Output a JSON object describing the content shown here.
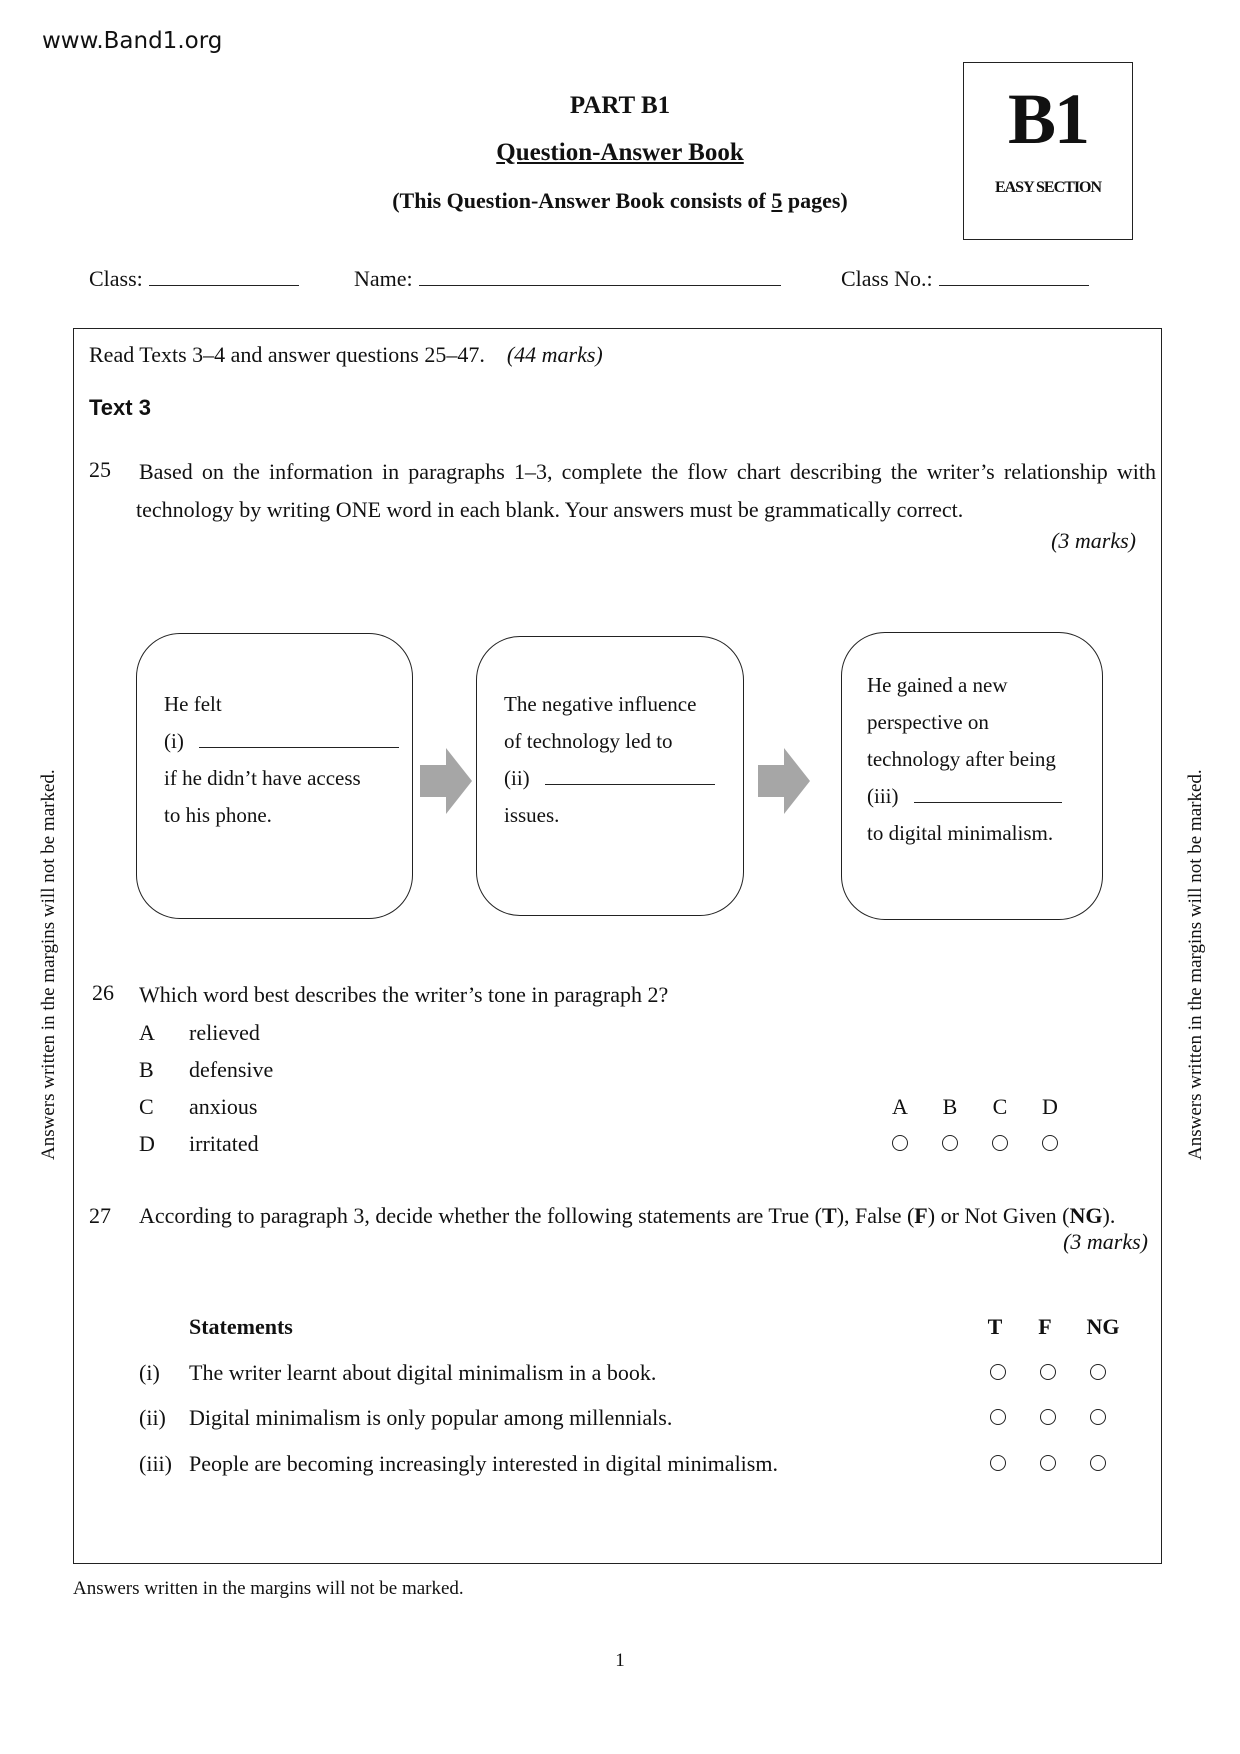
{
  "site": "www.Band1.org",
  "header": {
    "part": "PART B1",
    "title": "Question-Answer Book",
    "consists_prefix": "(This Question-Answer Book consists of ",
    "page_count": "5",
    "consists_suffix": " pages)"
  },
  "badge": {
    "code": "B1",
    "label": "EASY SECTION"
  },
  "fields": {
    "class_label": "Class:",
    "class_value": "",
    "name_label": "Name:",
    "name_value": "",
    "class_no_label": "Class No.:",
    "class_no_value": ""
  },
  "instructions": {
    "text": "Read Texts 3–4 and answer questions 25–47.",
    "marks": "(44 marks)"
  },
  "section_title": "Text 3",
  "q25": {
    "number": "25",
    "text": "Based on the information in paragraphs 1–3, complete the flow chart describing the writer’s relationship with technology by writing ONE word in each blank. Your answers must be grammatically correct.",
    "marks": "(3 marks)",
    "flow": [
      {
        "lines_before": [
          "He felt"
        ],
        "blank_label": "(i)",
        "answer": "",
        "lines_after": [
          "if he didn’t have access",
          "to his phone."
        ]
      },
      {
        "lines_before": [
          "The negative influence",
          "of technology led to"
        ],
        "blank_label": "(ii)",
        "answer": "",
        "lines_after": [
          "issues."
        ]
      },
      {
        "lines_before": [
          "He gained a new",
          "perspective on",
          "technology after being"
        ],
        "blank_label": "(iii)",
        "answer": "",
        "lines_after": [
          "to digital minimalism."
        ]
      }
    ],
    "arrow_color": "#a6a6a6"
  },
  "q26": {
    "number": "26",
    "text": "Which word best describes the writer’s tone in paragraph 2?",
    "options": [
      {
        "letter": "A",
        "text": "relieved"
      },
      {
        "letter": "B",
        "text": "defensive"
      },
      {
        "letter": "C",
        "text": "anxious"
      },
      {
        "letter": "D",
        "text": "irritated"
      }
    ],
    "answer_columns": [
      "A",
      "B",
      "C",
      "D"
    ],
    "selected": null
  },
  "q27": {
    "number": "27",
    "text_parts": [
      "According to paragraph 3, decide whether the following statements are True (",
      "T",
      "), False (",
      "F",
      ") or Not Given (",
      "NG",
      ")."
    ],
    "marks": "(3 marks)",
    "statements_header": "Statements",
    "columns": [
      "T",
      "F",
      "NG"
    ],
    "statements": [
      {
        "roman": "(i)",
        "text": "The writer learnt about digital minimalism in a book.",
        "selected": null
      },
      {
        "roman": "(ii)",
        "text": "Digital minimalism is only popular among millennials.",
        "selected": null
      },
      {
        "roman": "(iii)",
        "text": "People are becoming increasingly interested in digital minimalism.",
        "selected": null
      }
    ]
  },
  "margin_note": "Answers written in the margins will not be marked.",
  "footer_note": "Answers written in the margins will not be marked.",
  "page_number": "1"
}
